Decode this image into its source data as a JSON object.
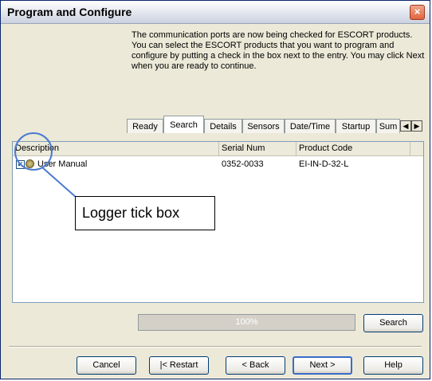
{
  "window": {
    "title": "Program and Configure",
    "close_glyph": "×"
  },
  "intro_text": "The communication ports are now being checked for ESCORT products. You can select the ESCORT products that you want to program and configure by putting a check in the box next to the entry. You may click Next when you are ready to continue.",
  "tabs": [
    {
      "label": "Ready"
    },
    {
      "label": "Search"
    },
    {
      "label": "Details"
    },
    {
      "label": "Sensors"
    },
    {
      "label": "Date/Time"
    },
    {
      "label": "Startup"
    },
    {
      "label": "Sum"
    }
  ],
  "list": {
    "columns": [
      "Description",
      "Serial Num",
      "Product Code"
    ],
    "rows": [
      {
        "checked": true,
        "icon": "logger-icon",
        "description": "User Manual",
        "serial": "0352-0033",
        "product_code": "EI-IN-D-32-L"
      }
    ]
  },
  "annotation": {
    "text": "Logger tick box",
    "color": "#4a7bd0"
  },
  "progress": {
    "text": "100%",
    "value": 1.0
  },
  "buttons": {
    "search": "Search",
    "cancel": "Cancel",
    "restart": "|< Restart",
    "back": "< Back",
    "next": "Next >",
    "help": "Help"
  }
}
